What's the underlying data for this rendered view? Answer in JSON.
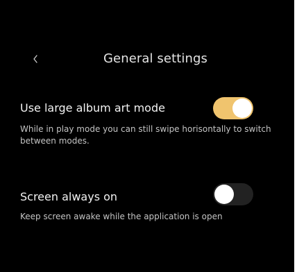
{
  "header": {
    "back_icon": "chevron-left-icon",
    "title": "General settings"
  },
  "settings": [
    {
      "title": "Use large album art mode",
      "description": "While in play mode you can still swipe horisontally to switch between modes.",
      "enabled": true
    },
    {
      "title": "Screen always on",
      "description": "Keep screen awake while the application is open",
      "enabled": false
    }
  ],
  "colors": {
    "background": "#000000",
    "toggle_on": "#f0c46e",
    "toggle_off": "#222222",
    "knob": "#ffffff"
  }
}
